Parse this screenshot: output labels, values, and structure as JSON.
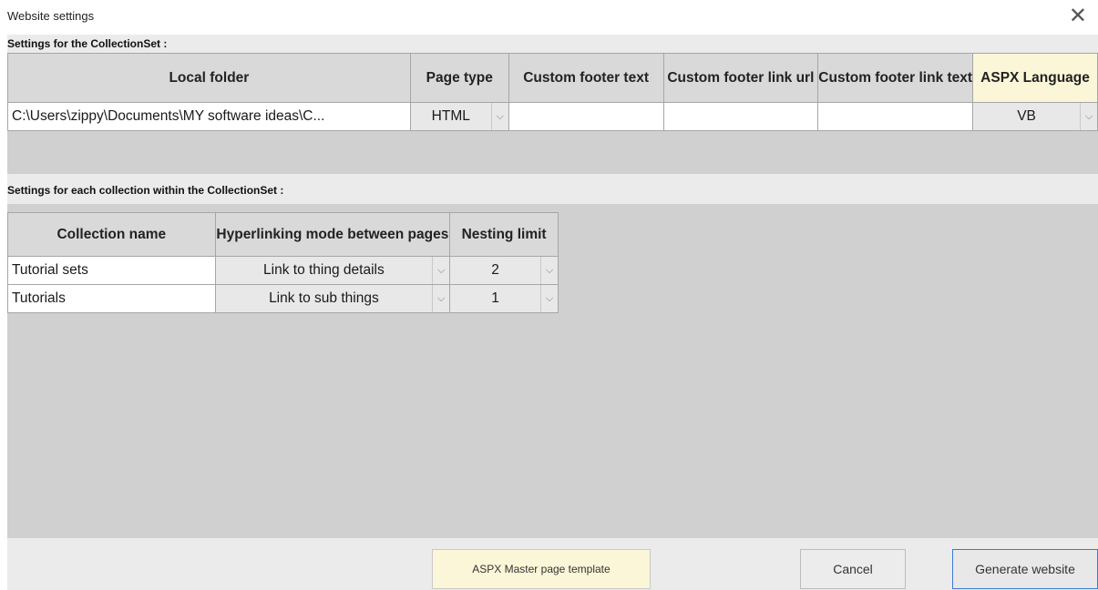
{
  "window": {
    "title": "Website settings"
  },
  "collectionset": {
    "section_label": "Settings for the CollectionSet :",
    "headers": {
      "local_folder": "Local folder",
      "page_type": "Page type",
      "footer_text": "Custom footer text",
      "footer_url": "Custom footer link url",
      "footer_link_text": "Custom footer link text",
      "aspx_language": "ASPX Language"
    },
    "row": {
      "local_folder": "C:\\Users\\zippy\\Documents\\MY software ideas\\C...",
      "page_type": "HTML",
      "footer_text": "",
      "footer_url": "",
      "footer_link_text": "",
      "aspx_language": "VB"
    }
  },
  "collections": {
    "section_label": "Settings for each collection within the CollectionSet :",
    "headers": {
      "name": "Collection name",
      "mode": "Hyperlinking mode between pages",
      "nesting": "Nesting limit"
    },
    "rows": [
      {
        "name": "Tutorial sets",
        "mode": "Link to thing details",
        "nesting": "2"
      },
      {
        "name": "Tutorials",
        "mode": "Link to sub things",
        "nesting": "1"
      }
    ]
  },
  "buttons": {
    "aspx_template": "ASPX Master page template",
    "cancel": "Cancel",
    "generate": "Generate website"
  },
  "icons": {
    "close": "close-icon",
    "dropdown": "chevron-down-icon"
  },
  "colors": {
    "accent_border": "#3a7bd5",
    "highlight_yellow": "#fbf6d8"
  }
}
